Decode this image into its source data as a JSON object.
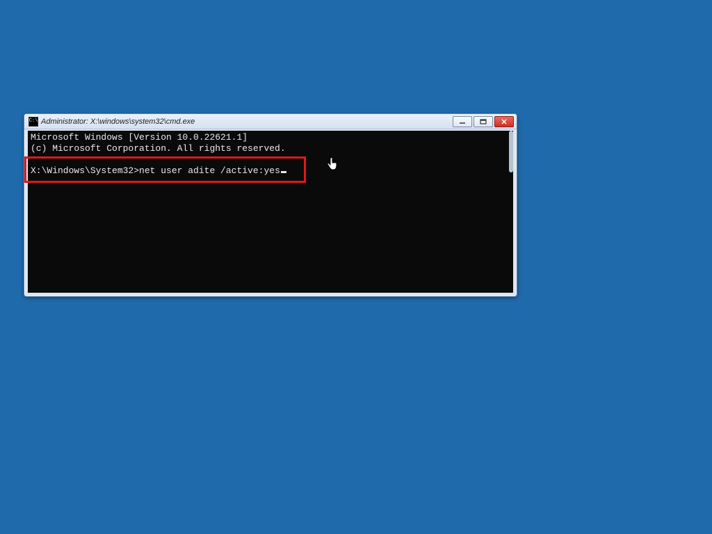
{
  "window": {
    "title": "Administrator: X:\\windows\\system32\\cmd.exe",
    "icon_text": "C:\\"
  },
  "buttons": {
    "minimize": "Minimize",
    "maximize": "Maximize",
    "close": "Close"
  },
  "terminal": {
    "line1": "Microsoft Windows [Version 10.0.22621.1]",
    "line2": "(c) Microsoft Corporation. All rights reserved.",
    "prompt": "X:\\Windows\\System32>",
    "command": "net user adite /active:yes"
  },
  "annotation": {
    "highlight_color": "#e11818"
  }
}
